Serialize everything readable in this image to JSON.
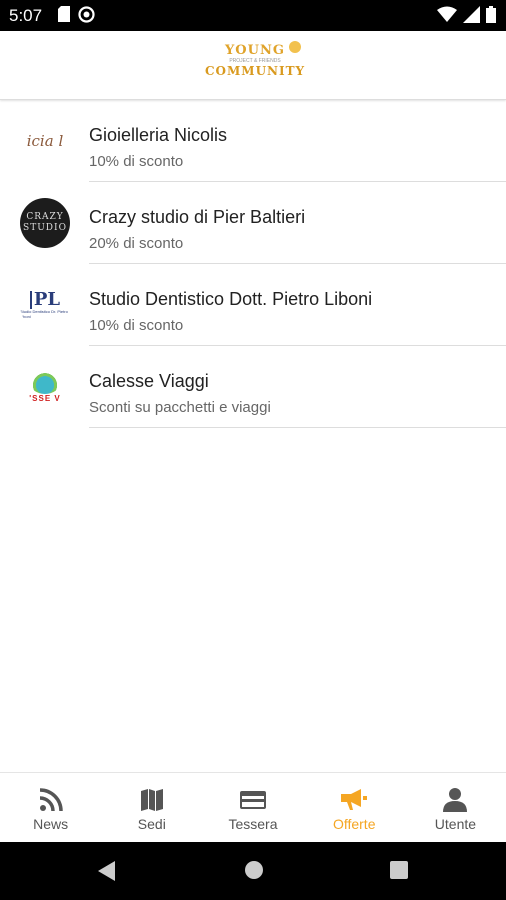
{
  "status_bar": {
    "time": "5:07"
  },
  "header": {
    "logo_line1": "YOUNG",
    "logo_line2": "PROJECT & FRIENDS",
    "logo_line3": "COMMUNITY"
  },
  "offers": [
    {
      "title": "Gioielleria Nicolis",
      "subtitle": "10% di sconto",
      "thumb_text": "icia l"
    },
    {
      "title": "Crazy studio di Pier Baltieri",
      "subtitle": "20% di sconto",
      "thumb_text": "CRAZY STUDIO"
    },
    {
      "title": "Studio Dentistico Dott. Pietro Liboni",
      "subtitle": "10% di sconto",
      "thumb_text": "PL",
      "thumb_small": "Studio Dentistico Dr. Pietro Liboni"
    },
    {
      "title": "Calesse Viaggi",
      "subtitle": "Sconti su pacchetti e viaggi",
      "thumb_text": "'SSE V"
    }
  ],
  "bottom_nav": [
    {
      "label": "News",
      "icon": "rss-icon"
    },
    {
      "label": "Sedi",
      "icon": "map-icon"
    },
    {
      "label": "Tessera",
      "icon": "card-icon"
    },
    {
      "label": "Offerte",
      "icon": "megaphone-icon",
      "active": true
    },
    {
      "label": "Utente",
      "icon": "user-icon"
    }
  ],
  "colors": {
    "accent": "#f5a623",
    "inactive": "#555555"
  }
}
